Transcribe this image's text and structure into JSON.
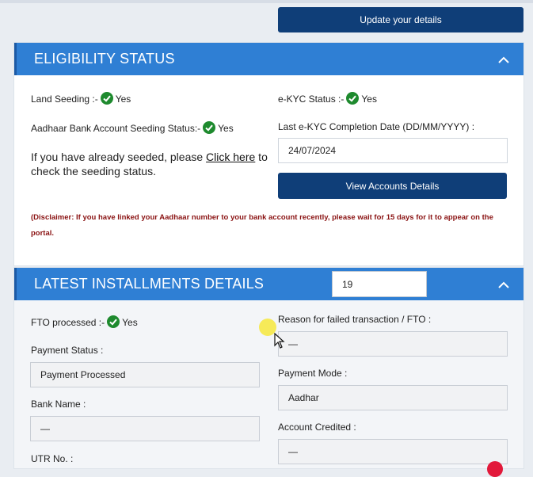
{
  "top": {
    "update_label": "Update your details"
  },
  "eligibility": {
    "title": "ELIGIBILITY STATUS",
    "land_seeding_label": "Land Seeding :-",
    "land_seeding_value": "Yes",
    "ekyc_status_label": "e-KYC Status :-",
    "ekyc_status_value": "Yes",
    "aadhaar_seeding_label": "Aadhaar Bank Account Seeding Status:-",
    "aadhaar_seeding_value": "Yes",
    "ekyc_date_label": "Last e-KYC Completion Date (DD/MM/YYYY) :",
    "ekyc_date_value": "24/07/2024",
    "seeded_text_before": "If you have already seeded, please ",
    "seeded_link": "Click here",
    "seeded_text_after": " to check the seeding status.",
    "view_accounts_label": "View Accounts Details",
    "disclaimer": "(Disclaimer: If you have linked your Aadhaar number to your bank account recently, please wait for 15 days for it to appear on the portal."
  },
  "installments": {
    "title": "LATEST INSTALLMENTS DETAILS",
    "selected_installment": "19",
    "fto_label": "FTO processed :-",
    "fto_value": "Yes",
    "reason_label": "Reason for failed transaction / FTO :",
    "reason_value": "—",
    "payment_status_label": "Payment Status :",
    "payment_status_value": "Payment Processed",
    "payment_mode_label": "Payment Mode :",
    "payment_mode_value": "Aadhar",
    "bank_name_label": "Bank Name :",
    "bank_name_value": "—",
    "account_credited_label": "Account Credited :",
    "account_credited_value": "—",
    "utr_label": "UTR No. :"
  },
  "colors": {
    "header_blue": "#2f7fd4",
    "navy_button": "#0f3e78",
    "check_green": "#1e8a2e",
    "disclaimer_red": "#8a1212"
  },
  "icons": {
    "check": "check-circle-icon",
    "chevron": "chevron-up-icon",
    "cursor": "mouse-cursor-icon"
  }
}
